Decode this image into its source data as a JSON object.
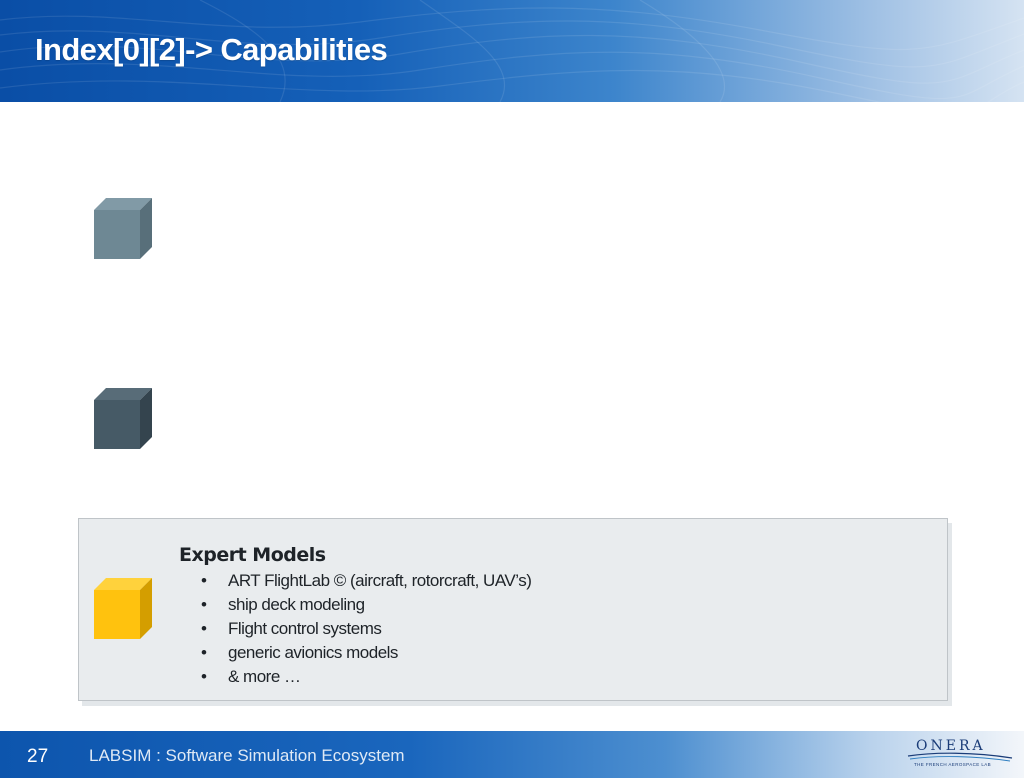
{
  "header": {
    "title": "Index[0][2]-> Capabilities"
  },
  "panel": {
    "title": "Expert Models",
    "bullets": [
      "ART FlightLab © (aircraft, rotorcraft, UAV’s)",
      "ship deck modeling",
      "Flight control systems",
      "generic avionics models",
      "& more …"
    ]
  },
  "footer": {
    "page_number": "27",
    "text": "LABSIM : Software Simulation Ecosystem"
  },
  "logo": {
    "word": "ONERA",
    "tagline": "THE FRENCH AEROSPACE LAB"
  },
  "cubes": [
    {
      "icon": "cube-icon",
      "front": "#6e8894",
      "top": "#819aa6",
      "side": "#586f7a"
    },
    {
      "icon": "cube-icon",
      "front": "#465a66",
      "top": "#586c78",
      "side": "#34444e"
    },
    {
      "icon": "cube-icon",
      "front": "#ffc20e",
      "top": "#ffd23c",
      "side": "#d49e00"
    }
  ],
  "colors": {
    "header_blue": "#0a4ea6",
    "panel_bg": "#e9ecee"
  }
}
